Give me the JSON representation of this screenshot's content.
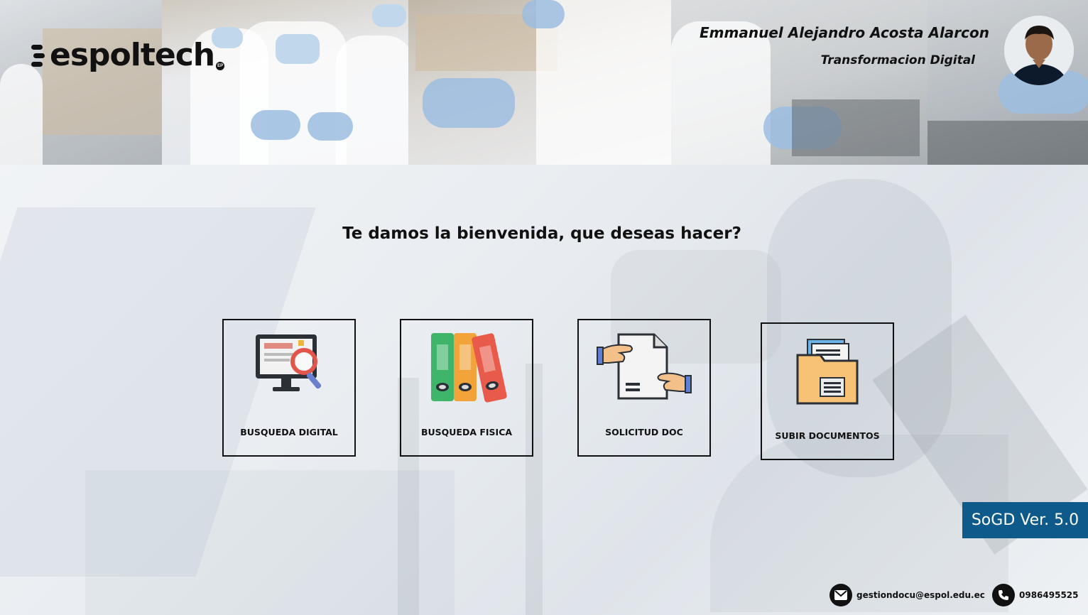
{
  "header": {
    "logo_text": "espoltech",
    "logo_badge": "EP",
    "user_name": "Emmanuel Alejandro Acosta Alarcon",
    "user_department": "Transformacion Digital"
  },
  "main": {
    "welcome": "Te damos la bienvenida, que deseas hacer?",
    "options": [
      {
        "label": "BUSQUEDA DIGITAL",
        "icon": "computer-search-icon"
      },
      {
        "label": "BUSQUEDA FISICA",
        "icon": "binders-icon"
      },
      {
        "label": "SOLICITUD DOC",
        "icon": "document-handover-icon"
      },
      {
        "label": "SUBIR DOCUMENTOS",
        "icon": "folder-documents-icon"
      }
    ]
  },
  "footer": {
    "version": "SoGD Ver. 5.0",
    "email": "gestiondocu@espol.edu.ec",
    "phone": "0986495525"
  },
  "colors": {
    "version_badge": "#0e5a8a",
    "text": "#111111"
  }
}
